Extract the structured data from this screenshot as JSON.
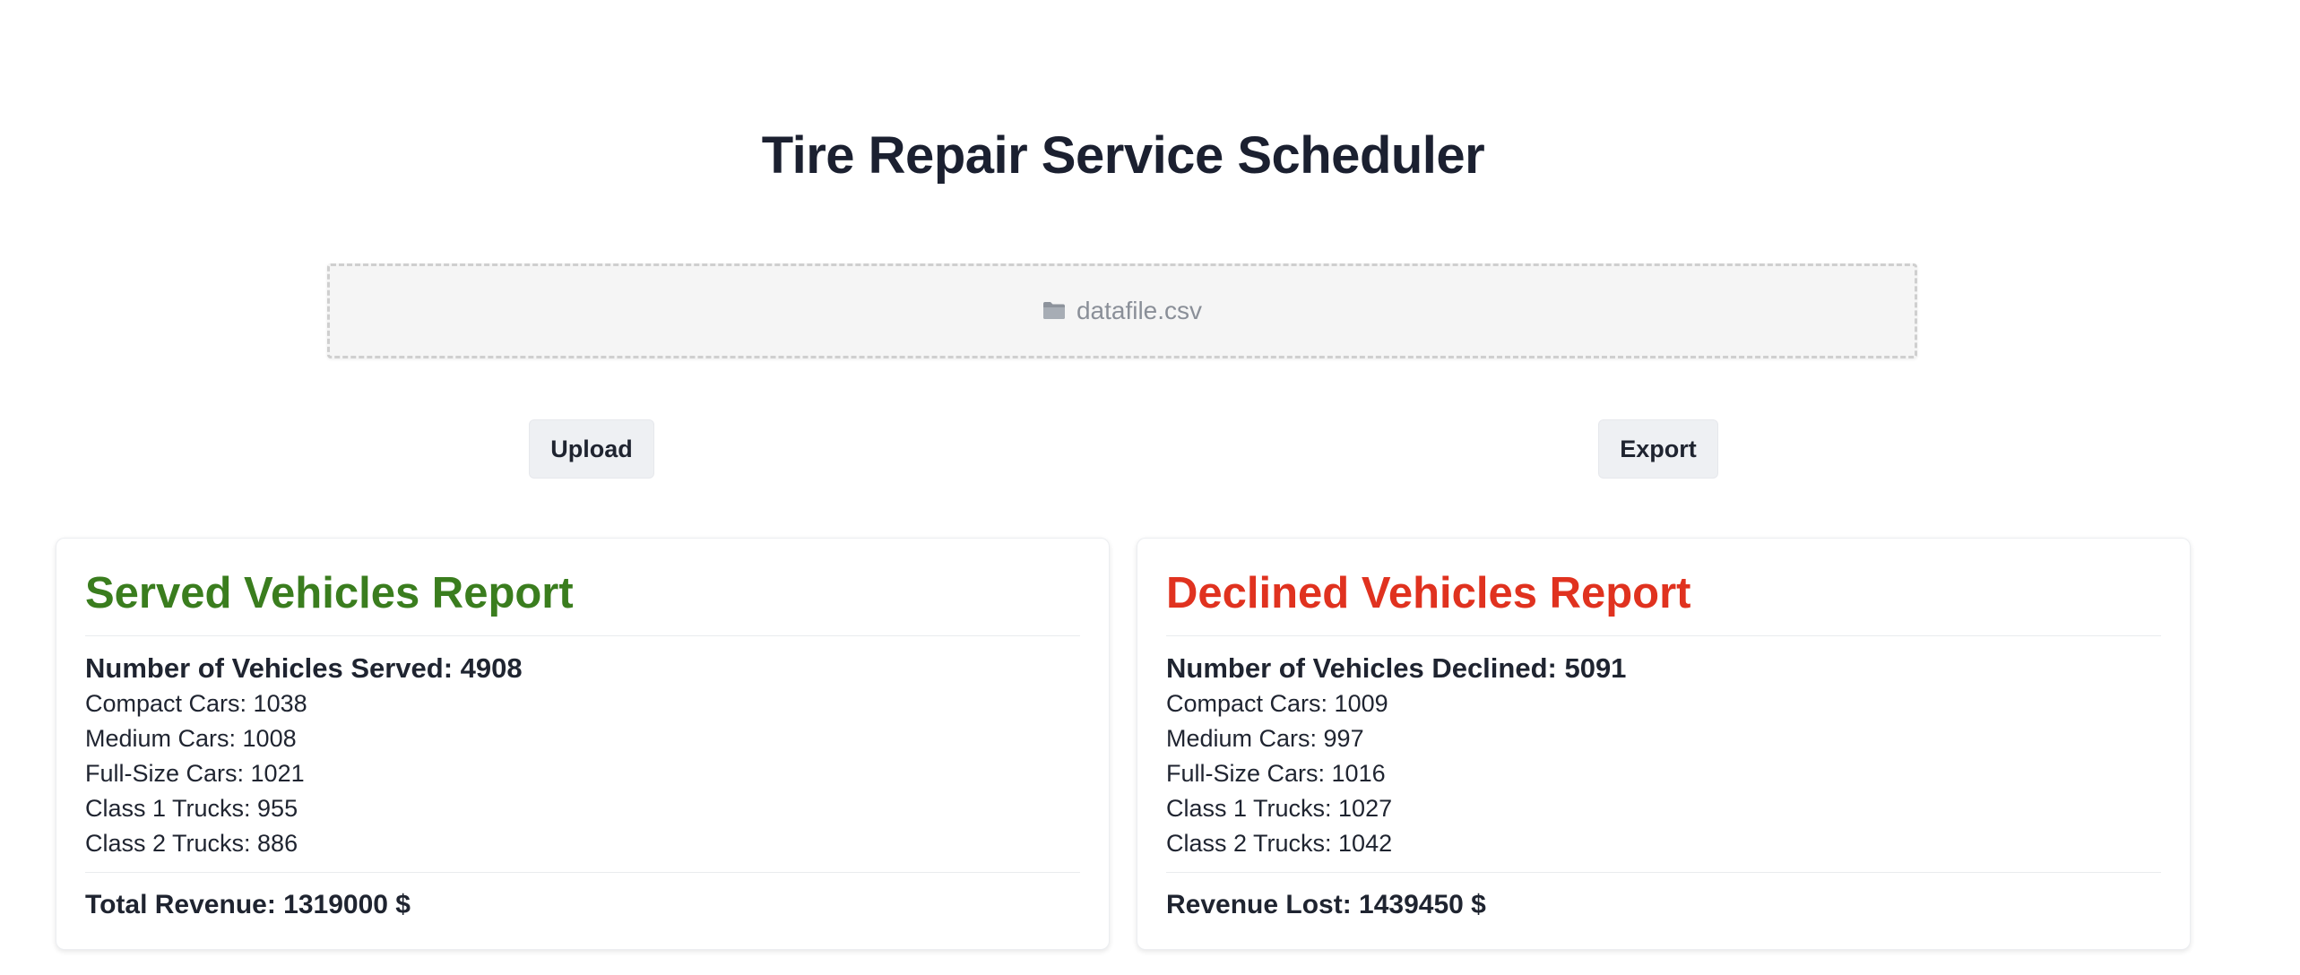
{
  "page": {
    "title": "Tire Repair Service Scheduler"
  },
  "dropzone": {
    "icon": "folder-icon",
    "filename": "datafile.csv"
  },
  "actions": {
    "upload_label": "Upload",
    "export_label": "Export"
  },
  "served_report": {
    "title": "Served Vehicles Report",
    "title_color": "#3a7d1e",
    "summary": "Number of Vehicles Served: 4908",
    "lines": [
      "Compact Cars: 1038",
      "Medium Cars: 1008",
      "Full-Size Cars: 1021",
      "Class 1 Trucks: 955",
      "Class 2 Trucks: 886"
    ],
    "total": "Total Revenue: 1319000 $"
  },
  "declined_report": {
    "title": "Declined Vehicles Report",
    "title_color": "#e0321f",
    "summary": "Number of Vehicles Declined: 5091",
    "lines": [
      "Compact Cars: 1009",
      "Medium Cars: 997",
      "Full-Size Cars: 1016",
      "Class 1 Trucks: 1027",
      "Class 2 Trucks: 1042"
    ],
    "total": "Revenue Lost: 1439450 $"
  }
}
